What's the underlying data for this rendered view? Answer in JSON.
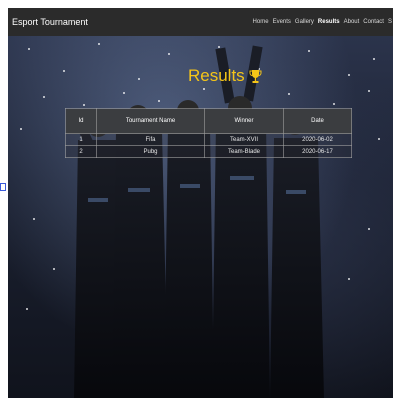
{
  "navbar": {
    "brand": "Esport Tournament",
    "links": [
      "Home",
      "Events",
      "Gallery",
      "Results",
      "About",
      "Contact",
      "S"
    ],
    "active": "Results"
  },
  "results": {
    "title": "Results",
    "trophy_icon": "trophy-icon",
    "title_color": "#f5c518"
  },
  "table": {
    "headers": [
      "Id",
      "Tournament Name",
      "Winner",
      "Date"
    ],
    "rows": [
      [
        "1",
        "Fifa",
        "Team-XVII",
        "2020-06-02"
      ],
      [
        "2",
        "Pubg",
        "Team-Blade",
        "2020-06-17"
      ]
    ]
  }
}
